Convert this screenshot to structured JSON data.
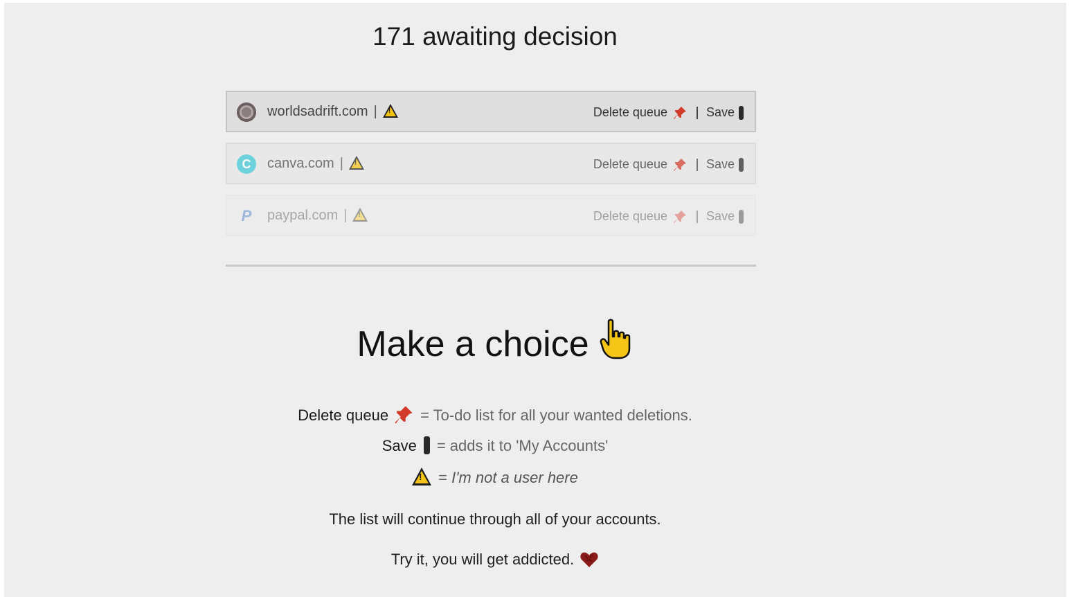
{
  "header": {
    "counter_text": "171 awaiting decision"
  },
  "queue": [
    {
      "domain": "worldsadrift.com",
      "favicon": "gear-icon",
      "separator": "|",
      "warning_icon": "warning-icon",
      "delete_label": "Delete queue",
      "save_label": "Save"
    },
    {
      "domain": "canva.com",
      "favicon": "canva-icon",
      "favicon_letter": "C",
      "separator": "|",
      "warning_icon": "warning-icon",
      "delete_label": "Delete queue",
      "save_label": "Save"
    },
    {
      "domain": "paypal.com",
      "favicon": "paypal-icon",
      "favicon_letter": "P",
      "separator": "|",
      "warning_icon": "warning-icon",
      "delete_label": "Delete queue",
      "save_label": "Save"
    }
  ],
  "main": {
    "headline": "Make a choice",
    "headline_icon": "pointing-hand-icon",
    "legend": {
      "delete_term": "Delete queue",
      "delete_desc": "= To-do list for all your wanted deletions.",
      "save_term": "Save",
      "save_desc": "= adds it to 'My Accounts'",
      "warn_eq": "=",
      "warn_desc": "I'm not a user here"
    },
    "info_line": "The list will continue through all of your accounts.",
    "addicted_line": "Try it, you will get addicted."
  },
  "colors": {
    "background": "#eeeeee",
    "row_background": "#dedede",
    "warning_yellow": "#f3c416",
    "pin_red": "#d23a2a",
    "hand_yellow": "#f5c518"
  }
}
